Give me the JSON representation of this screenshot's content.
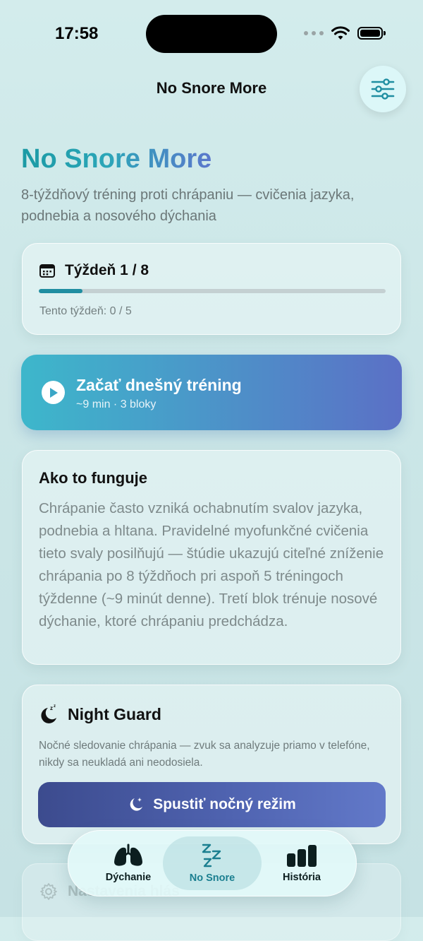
{
  "status": {
    "time": "17:58"
  },
  "nav": {
    "title": "No Snore More",
    "settings_icon": "sliders-icon"
  },
  "hero": {
    "title": "No Snore More",
    "subtitle": "8-týždňový tréning proti chrápaniu — cvičenia jazyka, podnebia a nosového dýchania"
  },
  "week": {
    "title": "Týždeň 1 / 8",
    "progress": 0.125,
    "count_text": "Tento týždeň: 0 / 5"
  },
  "start": {
    "title": "Začať dnešný tréning",
    "subtitle": "~9 min · 3 bloky"
  },
  "how": {
    "title": "Ako to funguje",
    "body": "Chrápanie často vzniká ochabnutím svalov jazyka, podnebia a hltana. Pravidelné myofunkčné cvičenia tieto svaly posilňujú — štúdie ukazujú citeľné zníženie chrápania po 8 týždňoch pri aspoň 5 tréningoch týždenne (~9 minút denne). Tretí blok trénuje nosové dýchanie, ktoré chrápaniu predchádza."
  },
  "night": {
    "title": "Night Guard",
    "description": "Nočné sledovanie chrápania — zvuk sa analyzuje priamo v telefóne, nikdy sa neukladá ani neodosiela.",
    "button_label": "Spustiť nočný režim"
  },
  "settings_card": {
    "label": "Nastavenia hlás"
  },
  "tabs": [
    {
      "label": "Dýchanie",
      "icon": "lungs-icon",
      "active": false
    },
    {
      "label": "No Snore",
      "icon": "zzz-icon",
      "active": true
    },
    {
      "label": "História",
      "icon": "bar-chart-icon",
      "active": false
    }
  ],
  "colors": {
    "accent": "#1f8ea1",
    "gradient_start": "#3db7cb",
    "gradient_end": "#5b70c6",
    "night": "#4f63b0"
  }
}
